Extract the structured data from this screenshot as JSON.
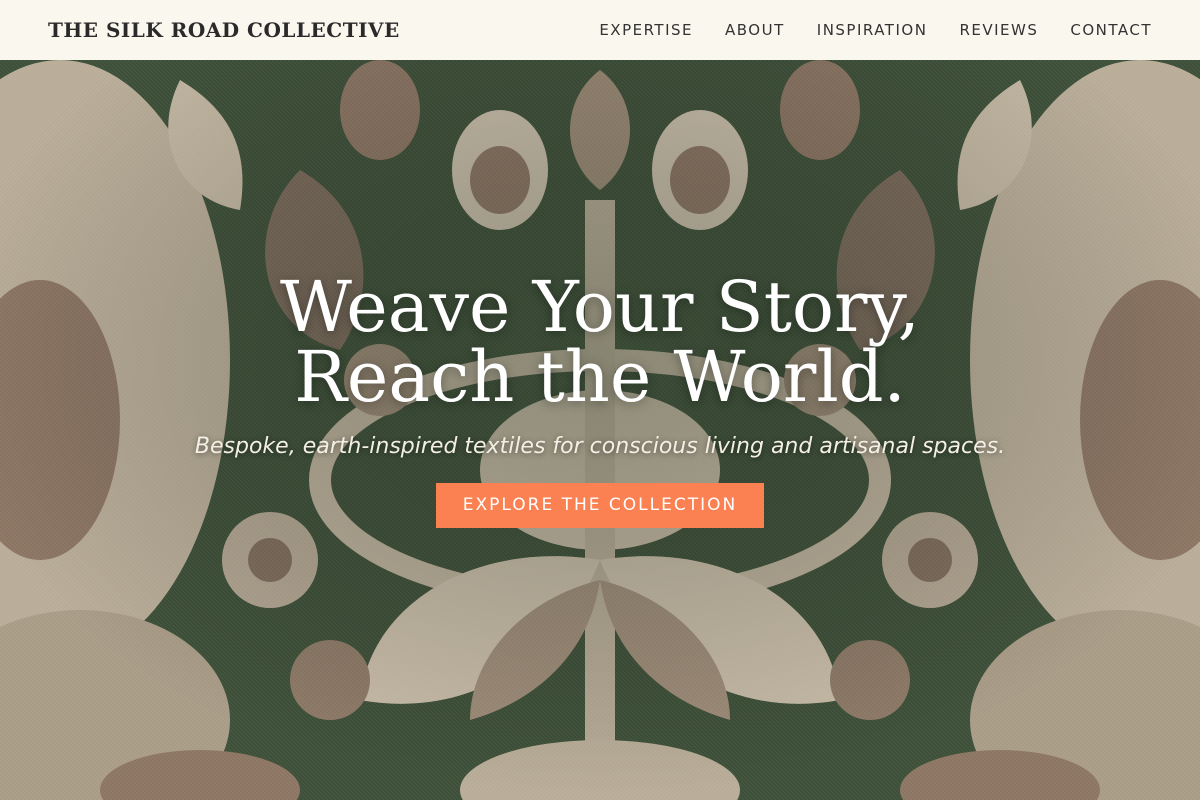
{
  "brand": {
    "name": "THE SILK ROAD COLLECTIVE"
  },
  "nav": {
    "items": [
      {
        "label": "EXPERTISE"
      },
      {
        "label": "ABOUT"
      },
      {
        "label": "INSPIRATION"
      },
      {
        "label": "REVIEWS"
      },
      {
        "label": "CONTACT"
      }
    ]
  },
  "hero": {
    "title": "Weave Your Story, Reach the World.",
    "subtitle": "Bespoke, earth-inspired textiles for conscious living and artisanal spaces.",
    "cta_label": "EXPLORE THE COLLECTION",
    "background": "damask-textile-pattern"
  },
  "colors": {
    "nav_bg": "#faf7ee",
    "cta": "#fb8152",
    "fabric_green": "#3e5039",
    "fabric_cream": "#cbbfab",
    "fabric_brown": "#8c7563"
  }
}
